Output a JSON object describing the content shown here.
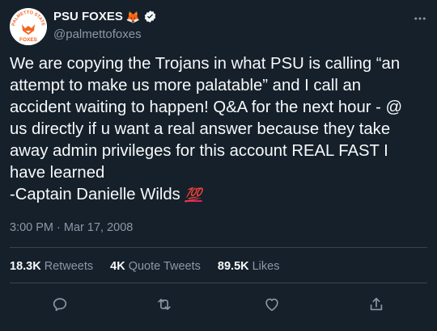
{
  "author": {
    "display_name": "PSU FOXES",
    "fox_emoji": "🦊",
    "handle": "@palmettofoxes",
    "avatar_text": {
      "top": "PALMETTO STATE",
      "bottom": "FOXES"
    }
  },
  "tweet": {
    "text": "We are copying the Trojans in what PSU is calling “an attempt to make us more palatable” and I call an accident waiting to happen! Q&A for the next hour - @ us directly if u want a real answer because they take away admin privileges for this account REAL FAST I have learned\n-Captain Danielle Wilds ",
    "emoji": "💯",
    "timestamp": "3:00 PM · Mar 17, 2008"
  },
  "stats": {
    "retweets_count": "18.3K",
    "retweets_label": "Retweets",
    "quotes_count": "4K",
    "quotes_label": "Quote Tweets",
    "likes_count": "89.5K",
    "likes_label": "Likes"
  },
  "icons": {
    "verified": "verified-badge-icon",
    "more": "more-options-icon",
    "reply": "reply-icon",
    "retweet": "retweet-icon",
    "like": "like-icon",
    "share": "share-icon"
  },
  "colors": {
    "background": "#15202b",
    "text": "#f7f9f9",
    "muted": "#8b98a5",
    "accent_orange": "#f26522",
    "hundred_red": "#e0245e"
  }
}
